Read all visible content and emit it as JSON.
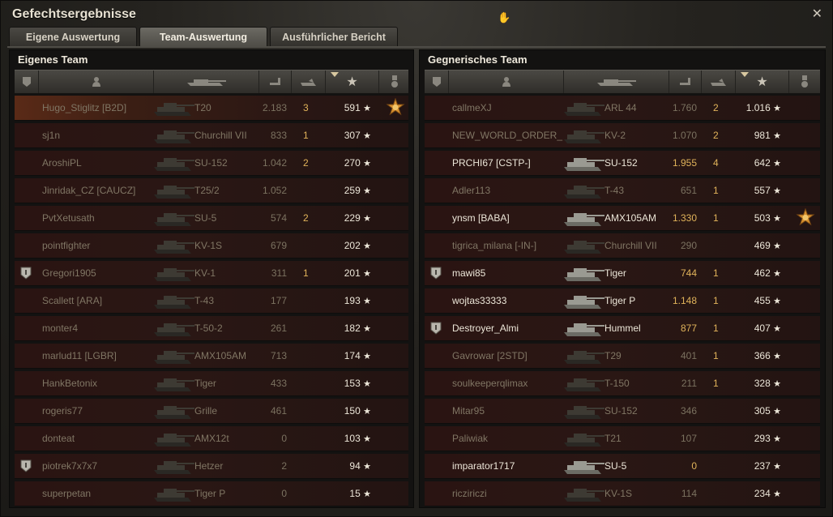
{
  "window": {
    "title": "Gefechtsergebnisse",
    "close_glyph": "✕"
  },
  "tabs": [
    {
      "label": "Eigene Auswertung",
      "active": false
    },
    {
      "label": "Team-Auswertung",
      "active": true
    },
    {
      "label": "Ausführlicher Bericht",
      "active": false
    }
  ],
  "own_team": {
    "title": "Eigenes Team",
    "rows": [
      {
        "name": "Hugo_Stiglitz [B2D]",
        "tank": "T20",
        "damage": "2.183",
        "kills": "3",
        "xp": "591",
        "alive": false,
        "mine": true,
        "rank_badge": false,
        "medal": true
      },
      {
        "name": "sj1n",
        "tank": "Churchill VII",
        "damage": "833",
        "kills": "1",
        "xp": "307",
        "alive": false,
        "rank_badge": false,
        "medal": false
      },
      {
        "name": "AroshiPL",
        "tank": "SU-152",
        "damage": "1.042",
        "kills": "2",
        "xp": "270",
        "alive": false,
        "rank_badge": false,
        "medal": false
      },
      {
        "name": "Jinridak_CZ [CAUCZ]",
        "tank": "T25/2",
        "damage": "1.052",
        "kills": "",
        "xp": "259",
        "alive": false,
        "rank_badge": false,
        "medal": false
      },
      {
        "name": "PvtXetusath",
        "tank": "SU-5",
        "damage": "574",
        "kills": "2",
        "xp": "229",
        "alive": false,
        "rank_badge": false,
        "medal": false
      },
      {
        "name": "pointfighter",
        "tank": "KV-1S",
        "damage": "679",
        "kills": "",
        "xp": "202",
        "alive": false,
        "rank_badge": false,
        "medal": false
      },
      {
        "name": "Gregori1905",
        "tank": "KV-1",
        "damage": "311",
        "kills": "1",
        "xp": "201",
        "alive": false,
        "rank_badge": true,
        "medal": false
      },
      {
        "name": "Scallett [ARA]",
        "tank": "T-43",
        "damage": "177",
        "kills": "",
        "xp": "193",
        "alive": false,
        "rank_badge": false,
        "medal": false
      },
      {
        "name": "monter4",
        "tank": "T-50-2",
        "damage": "261",
        "kills": "",
        "xp": "182",
        "alive": false,
        "rank_badge": false,
        "medal": false
      },
      {
        "name": "marlud11 [LGBR]",
        "tank": "AMX105AM",
        "damage": "713",
        "kills": "",
        "xp": "174",
        "alive": false,
        "rank_badge": false,
        "medal": false
      },
      {
        "name": "HankBetonix",
        "tank": "Tiger",
        "damage": "433",
        "kills": "",
        "xp": "153",
        "alive": false,
        "rank_badge": false,
        "medal": false
      },
      {
        "name": "rogeris77",
        "tank": "Grille",
        "damage": "461",
        "kills": "",
        "xp": "150",
        "alive": false,
        "rank_badge": false,
        "medal": false
      },
      {
        "name": "donteat",
        "tank": "AMX12t",
        "damage": "0",
        "kills": "",
        "xp": "103",
        "alive": false,
        "rank_badge": false,
        "medal": false
      },
      {
        "name": "piotrek7x7x7",
        "tank": "Hetzer",
        "damage": "2",
        "kills": "",
        "xp": "94",
        "alive": false,
        "rank_badge": true,
        "medal": false
      },
      {
        "name": "superpetan",
        "tank": "Tiger P",
        "damage": "0",
        "kills": "",
        "xp": "15",
        "alive": false,
        "rank_badge": false,
        "medal": false
      }
    ]
  },
  "enemy_team": {
    "title": "Gegnerisches Team",
    "rows": [
      {
        "name": "callmeXJ",
        "tank": "ARL 44",
        "damage": "1.760",
        "kills": "2",
        "xp": "1.016",
        "alive": false,
        "rank_badge": false,
        "medal": false
      },
      {
        "name": "NEW_WORLD_ORDER_",
        "tank": "KV-2",
        "damage": "1.070",
        "kills": "2",
        "xp": "981",
        "alive": false,
        "rank_badge": false,
        "medal": false
      },
      {
        "name": "PRCHI67 [CSTP-]",
        "tank": "SU-152",
        "damage": "1.955",
        "kills": "4",
        "xp": "642",
        "alive": true,
        "rank_badge": false,
        "medal": false
      },
      {
        "name": "Adler113",
        "tank": "T-43",
        "damage": "651",
        "kills": "1",
        "xp": "557",
        "alive": false,
        "rank_badge": false,
        "medal": false
      },
      {
        "name": "ynsm [BABA]",
        "tank": "AMX105AM",
        "damage": "1.330",
        "kills": "1",
        "xp": "503",
        "alive": true,
        "rank_badge": false,
        "medal": true
      },
      {
        "name": "tigrica_milana [-IN-]",
        "tank": "Churchill VII",
        "damage": "290",
        "kills": "",
        "xp": "469",
        "alive": false,
        "rank_badge": false,
        "medal": false
      },
      {
        "name": "mawi85",
        "tank": "Tiger",
        "damage": "744",
        "kills": "1",
        "xp": "462",
        "alive": true,
        "rank_badge": true,
        "medal": false
      },
      {
        "name": "wojtas33333",
        "tank": "Tiger P",
        "damage": "1.148",
        "kills": "1",
        "xp": "455",
        "alive": true,
        "rank_badge": false,
        "medal": false
      },
      {
        "name": "Destroyer_Almi",
        "tank": "Hummel",
        "damage": "877",
        "kills": "1",
        "xp": "407",
        "alive": true,
        "rank_badge": true,
        "medal": false
      },
      {
        "name": "Gavrowar [2STD]",
        "tank": "T29",
        "damage": "401",
        "kills": "1",
        "xp": "366",
        "alive": false,
        "rank_badge": false,
        "medal": false
      },
      {
        "name": "soulkeeperqlimax",
        "tank": "T-150",
        "damage": "211",
        "kills": "1",
        "xp": "328",
        "alive": false,
        "rank_badge": false,
        "medal": false
      },
      {
        "name": "Mitar95",
        "tank": "SU-152",
        "damage": "346",
        "kills": "",
        "xp": "305",
        "alive": false,
        "rank_badge": false,
        "medal": false
      },
      {
        "name": "Paliwiak",
        "tank": "T21",
        "damage": "107",
        "kills": "",
        "xp": "293",
        "alive": false,
        "rank_badge": false,
        "medal": false
      },
      {
        "name": "imparator1717",
        "tank": "SU-5",
        "damage": "0",
        "kills": "",
        "xp": "237",
        "alive": true,
        "rank_badge": false,
        "medal": false
      },
      {
        "name": "ricziriczi",
        "tank": "KV-1S",
        "damage": "114",
        "kills": "",
        "xp": "234",
        "alive": false,
        "rank_badge": false,
        "medal": false
      }
    ]
  },
  "icons": {
    "star": "★",
    "column_icons": [
      "rank-badge-icon",
      "player-icon",
      "tank-icon",
      "damage-icon",
      "kills-icon",
      "sort-arrow-icon",
      "xp-star-icon",
      "medal-icon"
    ]
  },
  "colors": {
    "alive_text": "#ece6d8",
    "dead_text": "#807664",
    "kills_text": "#e0b35a",
    "own_player_row": "#5a2a17"
  }
}
